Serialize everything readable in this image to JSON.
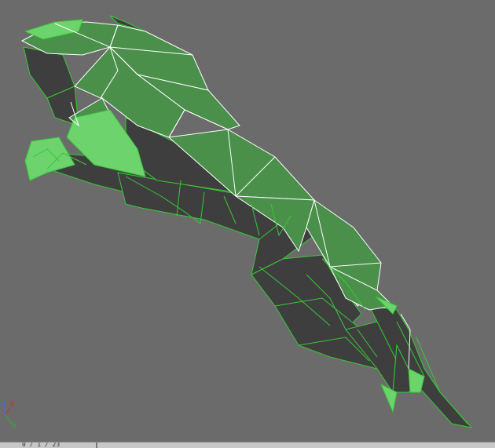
{
  "viewport": {
    "background": "#6b6b6b",
    "model": {
      "object": "low-poly-leaping-jaguar",
      "colors": {
        "face_light": "#6dd36d",
        "face_mid": "#4f9a4f",
        "face_dark": "#3d7a3d",
        "face_shadow": "#3e3e3e",
        "edge_green": "#38c838",
        "edge_white": "#ffffff"
      }
    }
  },
  "axis_gizmo": {
    "z_label": "z",
    "x_label": "x",
    "y_label": "y",
    "colors": {
      "x": "#c83030",
      "y": "#30b030",
      "z": "#4a6ad8"
    }
  },
  "status_bar": {
    "text": "0 / 1 / 23"
  }
}
